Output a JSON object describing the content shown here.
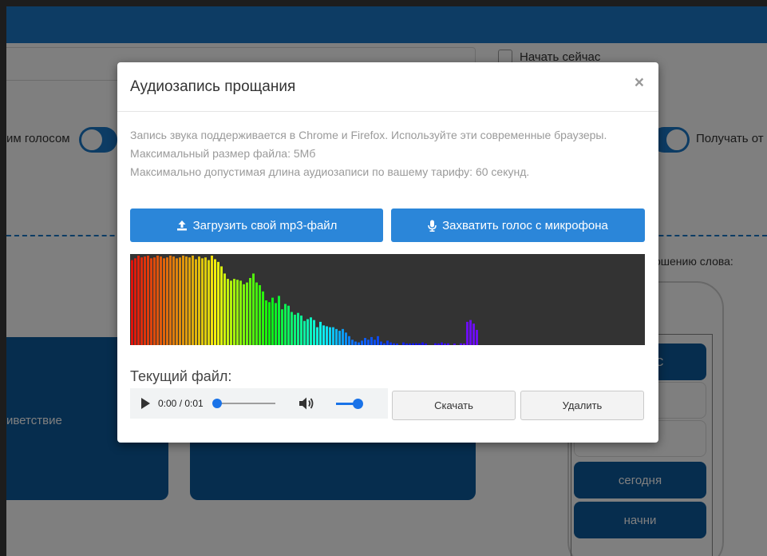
{
  "background": {
    "start_now_label": "Начать сейчас",
    "left_toggle_label": "им голосом",
    "right_toggle_label": "Получать от",
    "word_hint": "ошению слова:",
    "card_text": "иветствие",
    "words": [
      "ируйсяС",
      "",
      "",
      "сегодня",
      "начни"
    ]
  },
  "modal": {
    "title": "Аудиозапись прощания",
    "close_symbol": "×",
    "info_lines": [
      "Запись звука поддерживается в Chrome и Firefox. Используйте эти современные браузеры.",
      "Максимальный размер файла: 5Мб",
      "Максимально допустимая длина аудиозаписи по вашему тарифу: 60 секунд."
    ],
    "upload_button": "Загрузить свой mp3-файл",
    "mic_button": "Захватить голос с микрофона",
    "current_file_label": "Текущий файл:",
    "player": {
      "time": "0:00 / 0:01",
      "progress": 0.0,
      "volume": 1.0
    },
    "download_button": "Скачать",
    "delete_button": "Удалить"
  },
  "colors": {
    "header_blue": "#1a78c8",
    "button_blue": "#2b86d9",
    "card_blue": "#0d5a9c",
    "visualizer_bg": "#333333"
  },
  "icons": [
    "upload-icon",
    "microphone-icon",
    "play-icon",
    "volume-icon",
    "close-icon"
  ],
  "visualizer_levels": [
    0.95,
    0.97,
    1.0,
    0.98,
    0.99,
    1.0,
    0.97,
    0.98,
    1.0,
    0.99,
    0.97,
    0.98,
    1.0,
    0.99,
    0.97,
    0.98,
    1.0,
    0.99,
    0.98,
    1.0,
    0.96,
    0.99,
    0.97,
    0.98,
    0.95,
    1.0,
    0.96,
    0.93,
    0.88,
    0.8,
    0.74,
    0.72,
    0.74,
    0.73,
    0.72,
    0.68,
    0.7,
    0.75,
    0.8,
    0.7,
    0.67,
    0.6,
    0.5,
    0.48,
    0.53,
    0.47,
    0.55,
    0.4,
    0.46,
    0.44,
    0.37,
    0.34,
    0.36,
    0.33,
    0.27,
    0.29,
    0.31,
    0.28,
    0.2,
    0.26,
    0.22,
    0.21,
    0.2,
    0.2,
    0.18,
    0.16,
    0.18,
    0.14,
    0.1,
    0.06,
    0.04,
    0.03,
    0.05,
    0.08,
    0.06,
    0.09,
    0.06,
    0.1,
    0.04,
    0.02,
    0.05,
    0.03,
    0.02,
    0.01,
    0.0,
    0.03,
    0.01,
    0.01,
    0.02,
    0.02,
    0.01,
    0.03,
    0.01,
    0.0,
    0.0,
    0.02,
    0.01,
    0.03,
    0.01,
    0.02,
    0.0,
    0.01,
    0.0,
    0.02,
    0.01,
    0.26,
    0.28,
    0.24,
    0.17
  ]
}
